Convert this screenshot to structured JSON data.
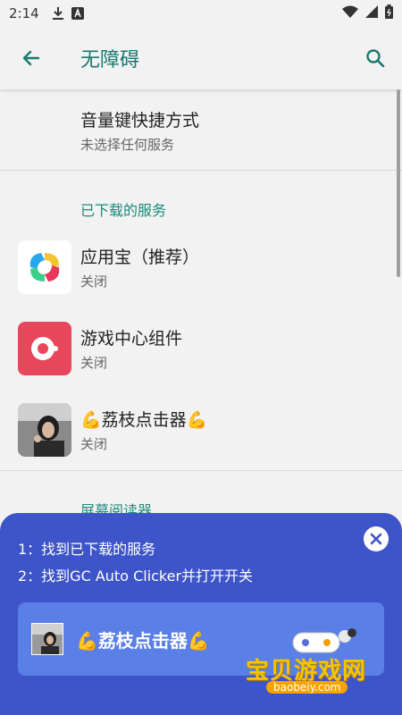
{
  "status_bar": {
    "time": "2:14",
    "icons": [
      "download-icon",
      "a-badge-icon",
      "wifi-icon",
      "signal-icon",
      "battery-icon"
    ]
  },
  "app_bar": {
    "title": "无障碍",
    "back_icon": "arrow-back-icon",
    "search_icon": "search-icon"
  },
  "shortcut": {
    "title": "音量键快捷方式",
    "subtitle": "未选择任何服务"
  },
  "downloaded_section": {
    "header": "已下载的服务",
    "items": [
      {
        "title": "应用宝（推荐）",
        "status": "关闭",
        "icon": "yingyongbao-icon"
      },
      {
        "title": "游戏中心组件",
        "status": "关闭",
        "icon": "game-center-icon"
      },
      {
        "title": "💪荔枝点击器💪",
        "status": "关闭",
        "icon": "avatar-photo-icon"
      }
    ]
  },
  "screen_reader_section": {
    "header": "屏幕阅读器"
  },
  "guide_sheet": {
    "step1": "1：找到已下载的服务",
    "step2": "2：找到GC Auto Clicker并打开开关",
    "card_label": "💪荔枝点击器💪",
    "close_icon": "close-icon"
  },
  "watermark": {
    "text": "宝贝游戏网",
    "url": "baobeiy.com"
  },
  "colors": {
    "accent": "#1a7a6f",
    "section": "#1a8a7a",
    "sheet": "#3e54c9",
    "card": "#5a7fe6"
  }
}
